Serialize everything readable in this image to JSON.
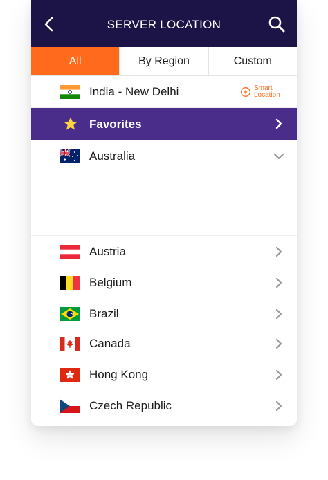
{
  "header": {
    "title": "SERVER LOCATION"
  },
  "tabs": [
    {
      "label": "All",
      "active": true
    },
    {
      "label": "By Region",
      "active": false
    },
    {
      "label": "Custom",
      "active": false
    }
  ],
  "current": {
    "label": "India - New Delhi",
    "flag": "india-flag",
    "smart_label": "Smart Location"
  },
  "favorites": {
    "label": "Favorites"
  },
  "expanded_country": {
    "label": "Australia",
    "flag": "australia-flag"
  },
  "countries": [
    {
      "label": "Austria",
      "flag": "austria-flag"
    },
    {
      "label": "Belgium",
      "flag": "belgium-flag"
    },
    {
      "label": "Brazil",
      "flag": "brazil-flag"
    },
    {
      "label": "Canada",
      "flag": "canada-flag"
    },
    {
      "label": "Hong Kong",
      "flag": "hong-kong-flag"
    },
    {
      "label": "Czech Republic",
      "flag": "czech-flag"
    }
  ],
  "colors": {
    "header": "#1c1346",
    "accent": "#ff6a1c",
    "favorites": "#4a2d8a"
  }
}
